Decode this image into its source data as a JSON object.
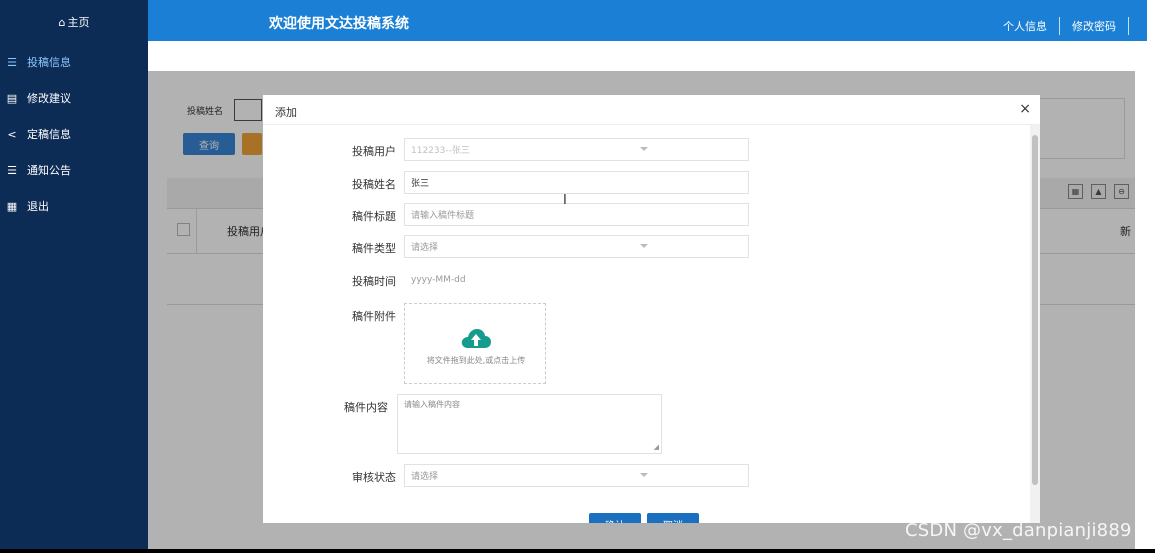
{
  "sidebar": {
    "home": "主页",
    "items": [
      {
        "label": "投稿信息",
        "icon": "list-icon"
      },
      {
        "label": "修改建议",
        "icon": "book-icon"
      },
      {
        "label": "定稿信息",
        "icon": "share-icon"
      },
      {
        "label": "通知公告",
        "icon": "list-icon"
      },
      {
        "label": "退出",
        "icon": "grid-icon"
      }
    ]
  },
  "header": {
    "title": "欢迎使用文达投稿系统",
    "profile": "个人信息",
    "change_password": "修改密码"
  },
  "page": {
    "search_label": "投稿姓名",
    "query_button": "查询",
    "table_col_1": "投稿用户",
    "table_col_last": "新"
  },
  "dialog": {
    "title": "添加",
    "close": "×",
    "fields": {
      "user_label": "投稿用户",
      "user_value": "112233--张三",
      "name_label": "投稿姓名",
      "name_value": "张三",
      "title_label": "稿件标题",
      "title_placeholder": "请输入稿件标题",
      "type_label": "稿件类型",
      "type_placeholder": "请选择",
      "time_label": "投稿时间",
      "time_placeholder": "yyyy-MM-dd",
      "attachment_label": "稿件附件",
      "upload_text": "将文件拖到此处,或点击上传",
      "content_label": "稿件内容",
      "content_placeholder": "请输入稿件内容",
      "status_label": "审核状态",
      "status_placeholder": "请选择"
    },
    "confirm": "确认",
    "cancel": "取消"
  },
  "watermark": "CSDN @vx_danpianji889",
  "colors": {
    "sidebar": "#0c2b55",
    "header": "#1a7fd5",
    "upload_icon": "#169c8c",
    "button": "#1a6fbf"
  }
}
